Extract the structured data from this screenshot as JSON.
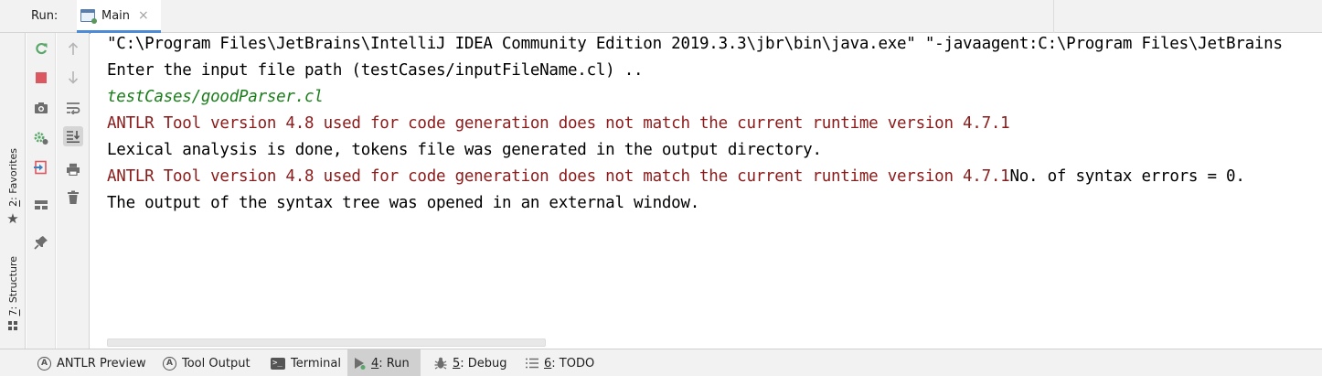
{
  "header": {
    "run_label": "Run:",
    "tab": {
      "label": "Main",
      "close": "×"
    }
  },
  "left_stripe": {
    "favorites": {
      "number": "2",
      "label": ": Favorites"
    },
    "structure": {
      "number": "7",
      "label": ": Structure"
    }
  },
  "toolbar": {
    "rerun": "rerun-icon",
    "stop": "stop-icon",
    "dump_threads": "camera-icon",
    "settings": "gear-icon",
    "exit": "exit-icon",
    "layout": "layout-icon",
    "pin": "pin-icon",
    "up": "arrow-up-icon",
    "down": "arrow-down-icon",
    "soft_wrap": "soft-wrap-icon",
    "scroll_to_end": "scroll-to-end-icon",
    "print": "print-icon",
    "clear": "trash-icon"
  },
  "console": {
    "lines": [
      {
        "text": "\"C:\\Program Files\\JetBrains\\IntelliJ IDEA Community Edition 2019.3.3\\jbr\\bin\\java.exe\" \"-javaagent:C:\\Program Files\\JetBrains",
        "style": "black"
      },
      {
        "text": "Enter the input file path (testCases/inputFileName.cl) ..",
        "style": "black"
      },
      {
        "text": "testCases/goodParser.cl",
        "style": "green"
      },
      {
        "text": "ANTLR Tool version 4.8 used for code generation does not match the current runtime version 4.7.1",
        "style": "red"
      },
      {
        "text": "Lexical analysis is done, tokens file was generated in the output directory.",
        "style": "black"
      },
      {
        "text_red": "ANTLR Tool version 4.8 used for code generation does not match the current runtime version 4.7.1",
        "text_black": "No. of syntax errors = 0.",
        "style": "mixed"
      },
      {
        "text": "The output of the syntax tree was opened in an external window.",
        "style": "black"
      }
    ]
  },
  "bottom_bar": {
    "items": [
      {
        "label": "ANTLR Preview",
        "icon": "antlr-icon"
      },
      {
        "label": "Tool Output",
        "icon": "antlr-icon"
      },
      {
        "label": "Terminal",
        "icon": "terminal-icon"
      },
      {
        "number": "4",
        "label": ": Run",
        "icon": "run-icon",
        "active": true
      },
      {
        "number": "5",
        "label": ": Debug",
        "icon": "bug-icon"
      },
      {
        "number": "6",
        "label": ": TODO",
        "icon": "todo-icon"
      }
    ]
  },
  "colors": {
    "output_black": "#000000",
    "input_green": "#1a7f1a",
    "error_red": "#8b1a1a",
    "tab_accent": "#4d8bd8"
  }
}
